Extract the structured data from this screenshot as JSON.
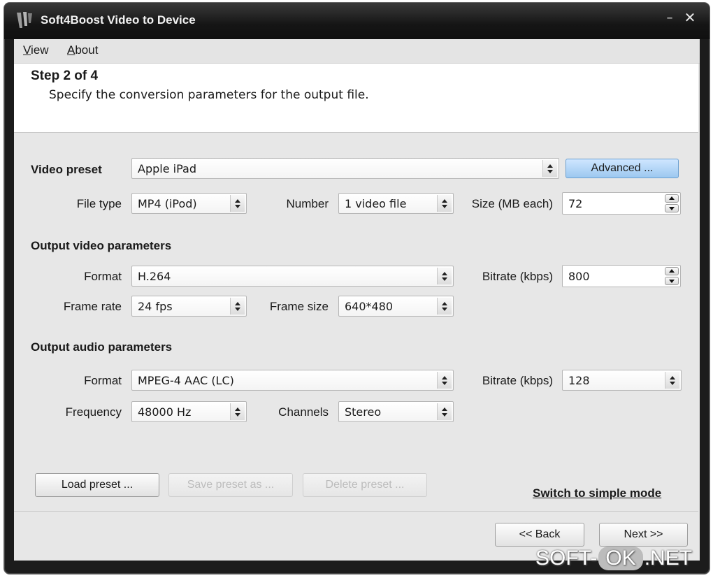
{
  "window": {
    "title": "Soft4Boost Video to Device"
  },
  "menu": [
    {
      "label": "View",
      "accel": "V",
      "rest": "iew"
    },
    {
      "label": "About",
      "accel": "A",
      "rest": "bout"
    }
  ],
  "header": {
    "step": "Step 2 of 4",
    "description": "Specify the conversion parameters for the output file."
  },
  "preset": {
    "label": "Video preset",
    "value": "Apple iPad",
    "advanced_button": "Advanced ...",
    "file_type_label": "File type",
    "file_type": "MP4 (iPod)",
    "number_label": "Number",
    "number": "1 video file",
    "size_label": "Size (MB each)",
    "size": "72"
  },
  "video": {
    "section": "Output video parameters",
    "format_label": "Format",
    "format": "H.264",
    "bitrate_label": "Bitrate (kbps)",
    "bitrate": "800",
    "frame_rate_label": "Frame rate",
    "frame_rate": "24 fps",
    "frame_size_label": "Frame size",
    "frame_size": "640*480"
  },
  "audio": {
    "section": "Output audio parameters",
    "format_label": "Format",
    "format": "MPEG-4 AAC (LC)",
    "bitrate_label": "Bitrate (kbps)",
    "bitrate": "128",
    "frequency_label": "Frequency",
    "frequency": "48000 Hz",
    "channels_label": "Channels",
    "channels": "Stereo"
  },
  "buttons": {
    "load_preset": "Load preset ...",
    "save_preset": "Save preset as ...",
    "delete_preset": "Delete preset ...",
    "switch_mode": "Switch to simple mode",
    "back": "<< Back",
    "next": "Next >>"
  },
  "watermark": {
    "left": "SOFT-",
    "mid": "OK",
    "right": ".NET"
  }
}
